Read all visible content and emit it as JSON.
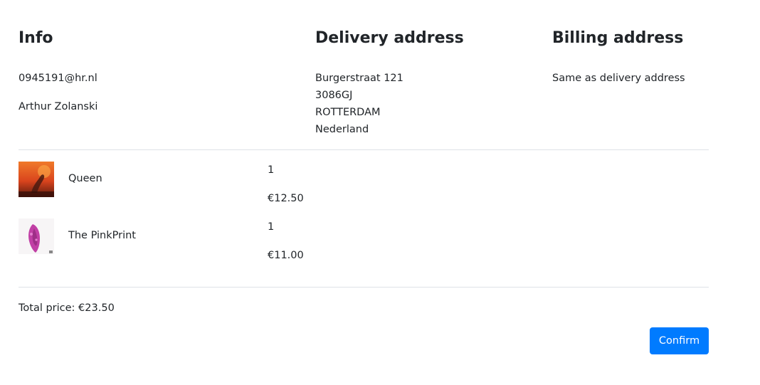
{
  "info": {
    "heading": "Info",
    "email": "0945191@hr.nl",
    "name": "Arthur Zolanski"
  },
  "delivery": {
    "heading": "Delivery address",
    "street": "Burgerstraat 121",
    "postcode": "3086GJ",
    "city": "ROTTERDAM",
    "country": "Nederland"
  },
  "billing": {
    "heading": "Billing address",
    "text": "Same as delivery address"
  },
  "items": [
    {
      "title": "Queen",
      "quantity": "1",
      "price": "€12.50",
      "cover_icon": "album-cover-queen"
    },
    {
      "title": "The PinkPrint",
      "quantity": "1",
      "price": "€11.00",
      "cover_icon": "album-cover-pinkprint"
    }
  ],
  "total": {
    "text": "Total price: €23.50"
  },
  "actions": {
    "confirm_label": "Confirm"
  },
  "colors": {
    "primary": "#007bff",
    "text": "#212529",
    "divider": "#dee2e6"
  }
}
